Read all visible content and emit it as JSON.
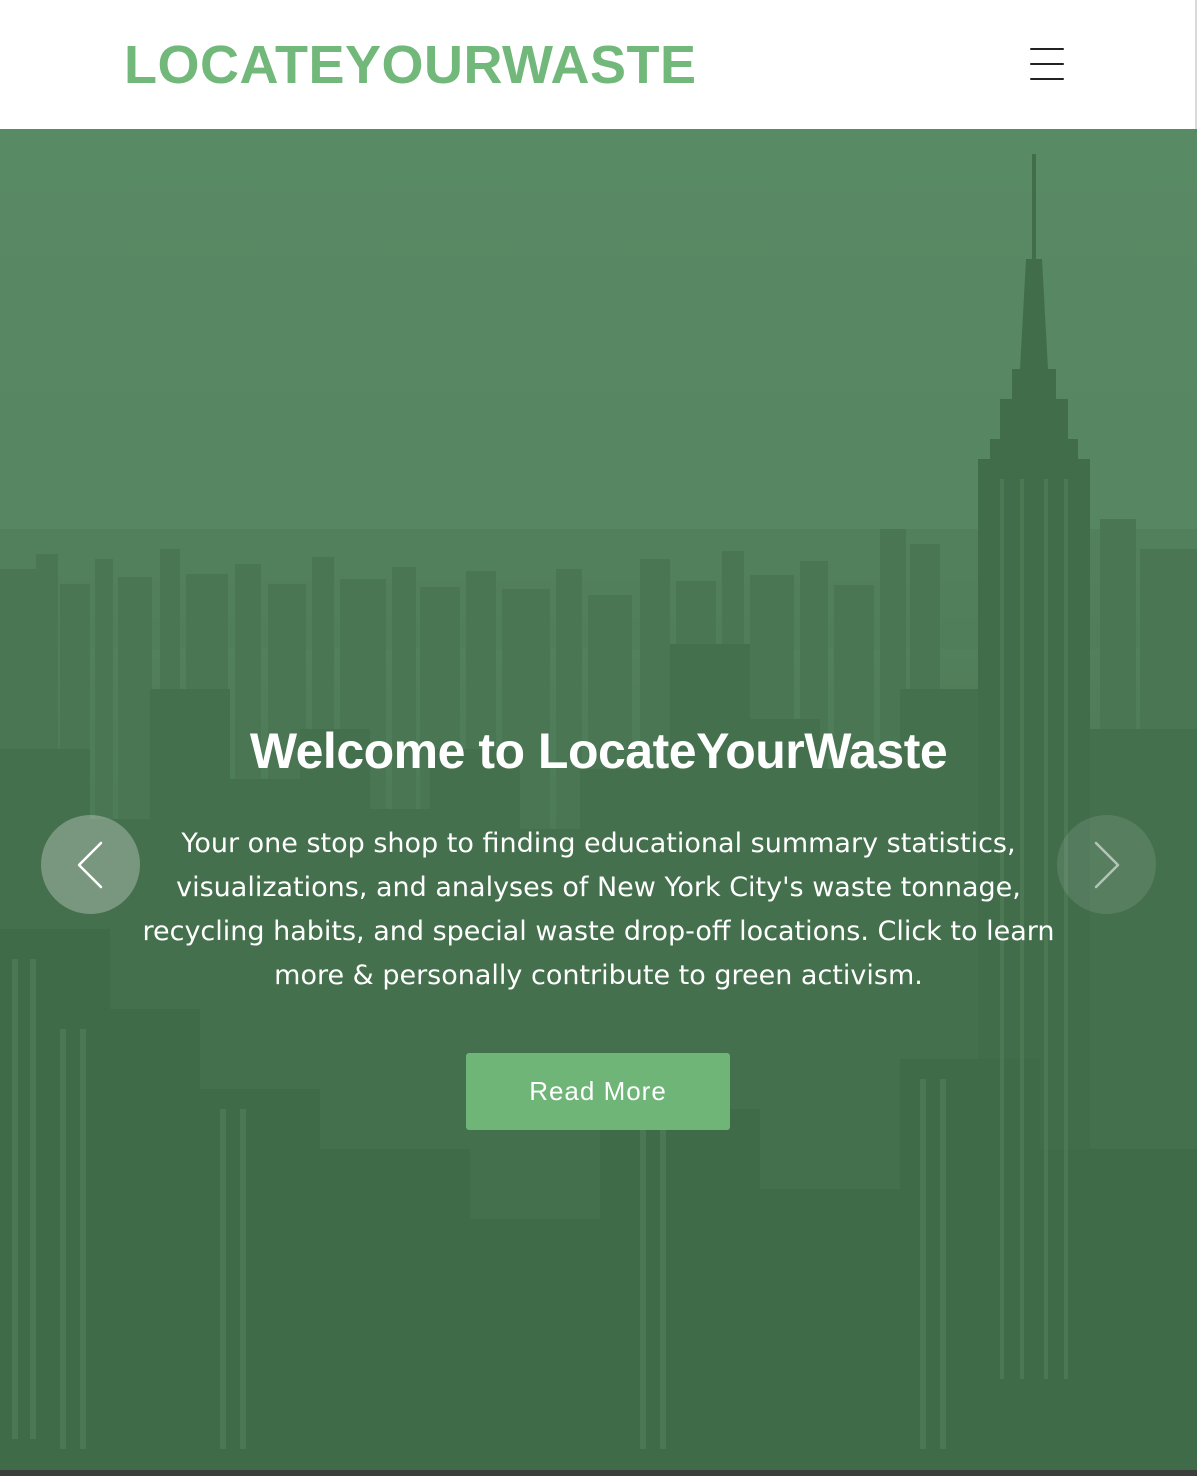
{
  "header": {
    "brand": "LOCATEYOURWASTE",
    "menu_icon": "hamburger-menu-icon"
  },
  "hero": {
    "title": "Welcome to LocateYourWaste",
    "text": "Your one stop shop to finding educational summary statistics, visualizations, and analyses of New York City's waste tonnage, recycling habits, and special waste drop-off locations. Click to learn more & personally contribute to green activism.",
    "button_label": "Read More",
    "prev_icon": "chevron-left-icon",
    "next_icon": "chevron-right-icon",
    "background": "new-york-city-skyline-image"
  },
  "colors": {
    "brand": "#72b87a",
    "button": "#6fb578",
    "hero_tint": "#4a7554"
  }
}
